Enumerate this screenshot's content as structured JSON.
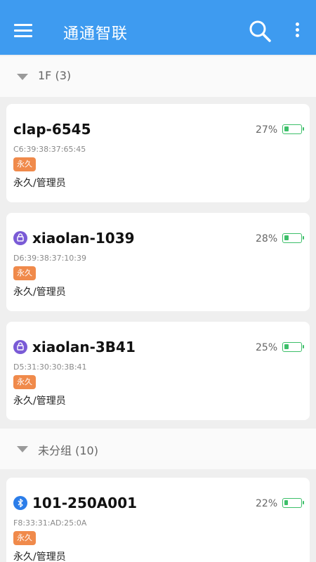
{
  "appbar": {
    "title": "通通智联",
    "menu_icon": "hamburger-menu-icon",
    "search_icon": "search-icon",
    "more_icon": "more-vertical-icon",
    "color": "#3e9bf0"
  },
  "groups": [
    {
      "label": "1F (3)",
      "expanded": true
    },
    {
      "label": "未分组 (10)",
      "expanded": true
    }
  ],
  "devices": [
    {
      "name": "clap-6545",
      "mac": "C6:39:38:37:65:45",
      "badge": "永久",
      "role": "永久/管理员",
      "battery_text": "27%",
      "battery_level": 0.27,
      "icon": "none"
    },
    {
      "name": "xiaolan-1039",
      "mac": "D6:39:38:37:10:39",
      "badge": "永久",
      "role": "永久/管理员",
      "battery_text": "28%",
      "battery_level": 0.28,
      "icon": "lock-device-icon"
    },
    {
      "name": "xiaolan-3B41",
      "mac": "D5:31:30:30:3B:41",
      "badge": "永久",
      "role": "永久/管理员",
      "battery_text": "25%",
      "battery_level": 0.25,
      "icon": "lock-device-icon"
    },
    {
      "name": "101-250A001",
      "mac": "F8:33:31:AD:25:0A",
      "badge": "永久",
      "role": "永久/管理员",
      "battery_text": "22%",
      "battery_level": 0.22,
      "icon": "bluetooth-lock-icon"
    }
  ],
  "colors": {
    "badge": "#f08a4b",
    "battery": "#3cbf69",
    "lock_icon": "#7a5bd6",
    "bluetooth_icon": "#2b7de9"
  }
}
